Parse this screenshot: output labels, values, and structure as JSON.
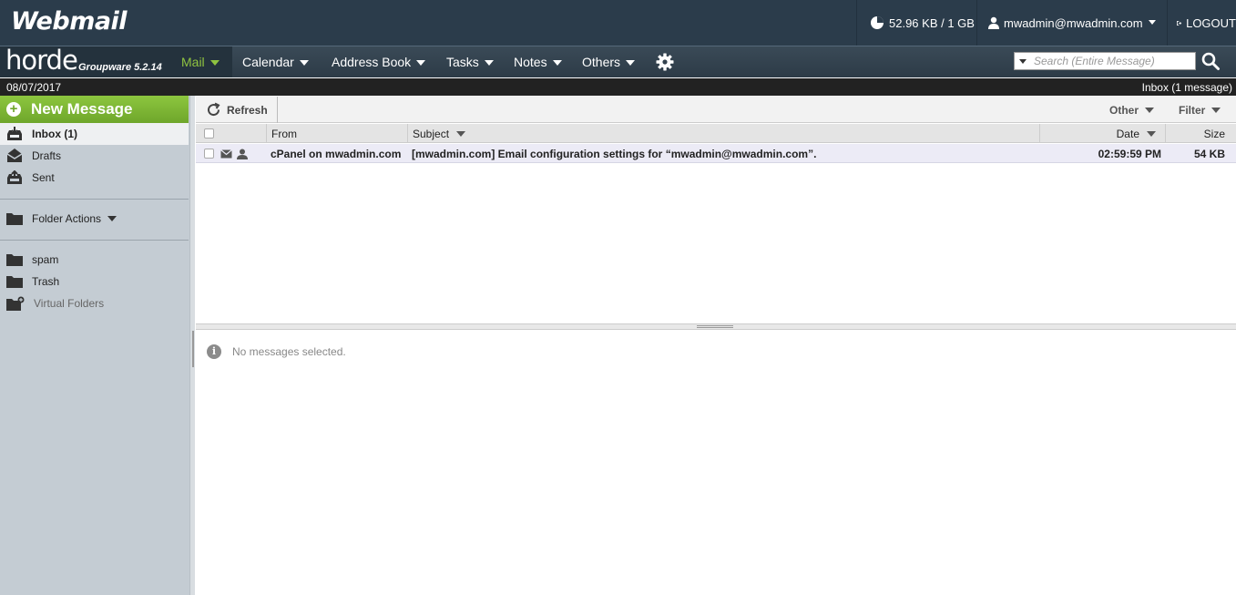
{
  "app": {
    "logo": "Webmail",
    "brand": "horde",
    "brand_sub": "Groupware 5.2.14"
  },
  "top": {
    "quota": "52.96 KB / 1 GB",
    "user": "mwadmin@mwadmin.com",
    "logout": "LOGOUT"
  },
  "nav": {
    "items": [
      "Mail",
      "Calendar",
      "Address Book",
      "Tasks",
      "Notes",
      "Others"
    ],
    "search_placeholder": "Search (Entire Message)"
  },
  "status": {
    "date": "08/07/2017",
    "inbox": "Inbox (1 message)"
  },
  "sidebar": {
    "new_message": "New Message",
    "inbox": "Inbox (1)",
    "drafts": "Drafts",
    "sent": "Sent",
    "folder_actions": "Folder Actions",
    "spam": "spam",
    "trash": "Trash",
    "virtual_folders": "Virtual Folders"
  },
  "toolbar": {
    "refresh": "Refresh",
    "other": "Other",
    "filter": "Filter"
  },
  "columns": {
    "from": "From",
    "subject": "Subject",
    "date": "Date",
    "size": "Size"
  },
  "messages": [
    {
      "from": "cPanel on mwadmin.com",
      "subject": "[mwadmin.com] Email configuration settings for “mwadmin@mwadmin.com”.",
      "date": "02:59:59 PM",
      "size": "54 KB"
    }
  ],
  "preview": {
    "empty": "No messages selected."
  },
  "colors": {
    "topbar": "#2b3c4b",
    "accent_green": "#8dc63f",
    "sidebar_bg": "#c4ccd3",
    "row_highlight": "#ecebf6"
  }
}
